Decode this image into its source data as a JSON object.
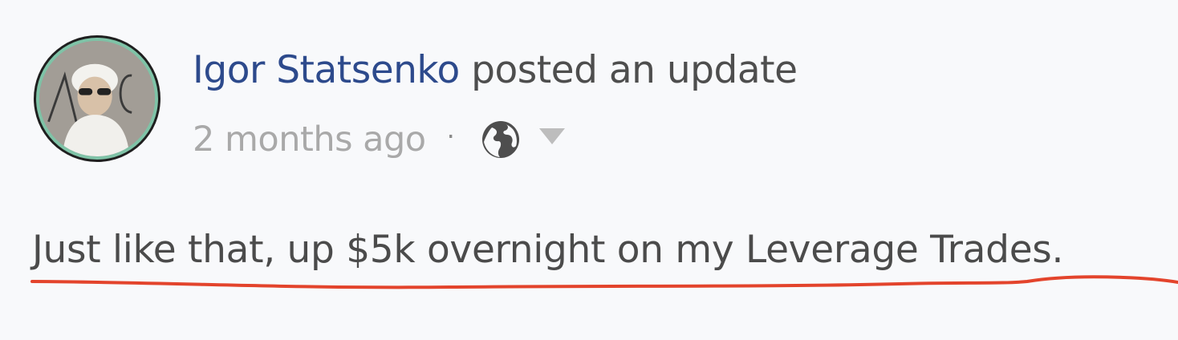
{
  "post": {
    "author": "Igor Statsenko",
    "action": "posted an update",
    "time": "2 months ago",
    "separator": "·",
    "visibility_icon": "globe-icon",
    "options_icon": "caret-down-icon",
    "content": "Just like that, up $5k overnight on my Leverage Trades."
  },
  "colors": {
    "author_link": "#2d4a8c",
    "annotation_underline": "#e3442c",
    "avatar_ring": "#7fc3a7"
  }
}
